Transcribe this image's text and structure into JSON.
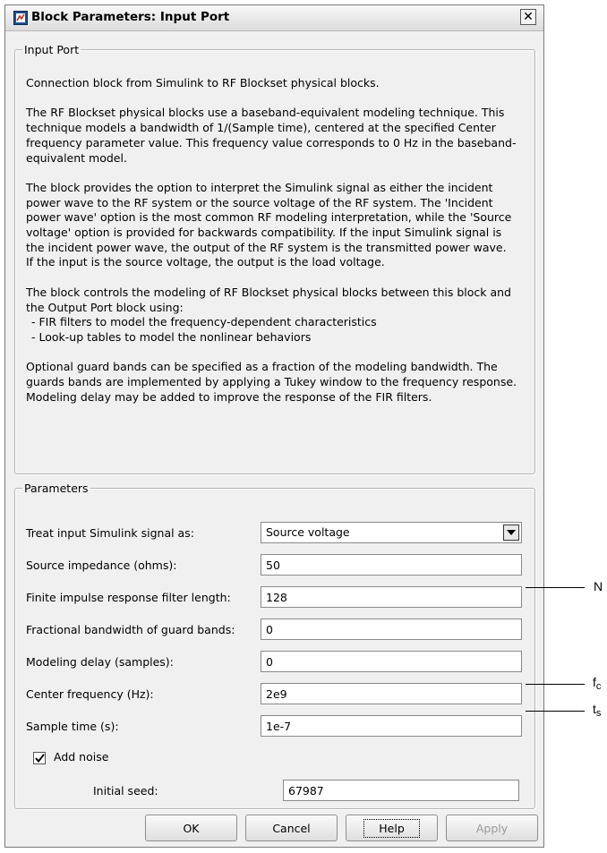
{
  "window": {
    "title": "Block Parameters: Input Port",
    "close_symbol": "✕"
  },
  "description_group": {
    "legend": "Input Port",
    "paragraphs": [
      "Connection block from Simulink to RF Blockset physical blocks.",
      "The RF Blockset physical blocks use a baseband-equivalent modeling technique. This technique models a bandwidth of 1/(Sample time), centered at the specified Center frequency parameter value. This frequency value corresponds to 0 Hz in the baseband-equivalent model.",
      "The block provides the option to interpret the Simulink signal as either the incident power wave to the RF system or the source voltage of the RF system. The 'Incident power wave' option is the most common RF modeling interpretation, while the 'Source voltage' option is provided for backwards compatibility. If the input Simulink signal is the incident power wave, the output of the RF system is the transmitted power wave. If the input is the source voltage, the output is the load voltage.",
      "The block controls the modeling of RF Blockset physical blocks between this block and the Output Port block using:",
      "Optional guard bands can be specified as a fraction of the modeling bandwidth. The guards bands are implemented by applying a Tukey window to the frequency response. Modeling delay may be added to improve the response of the FIR filters."
    ],
    "bullets": [
      "- FIR filters to model the frequency-dependent characteristics",
      "- Look-up tables to model the nonlinear behaviors"
    ]
  },
  "parameters_group": {
    "legend": "Parameters",
    "treat_input": {
      "label": "Treat input Simulink signal as:",
      "value": "Source voltage"
    },
    "source_impedance": {
      "label": "Source impedance (ohms):",
      "value": "50"
    },
    "fir_length": {
      "label": "Finite impulse response filter length:",
      "value": "128"
    },
    "guard_bandwidth": {
      "label": "Fractional bandwidth of guard bands:",
      "value": "0"
    },
    "modeling_delay": {
      "label": "Modeling delay (samples):",
      "value": "0"
    },
    "center_frequency": {
      "label": "Center frequency (Hz):",
      "value": "2e9"
    },
    "sample_time": {
      "label": "Sample time (s):",
      "value": "1e-7"
    },
    "add_noise": {
      "label": "Add noise",
      "checked": true
    },
    "initial_seed": {
      "label": "Initial seed:",
      "value": "67987"
    }
  },
  "buttons": {
    "ok": "OK",
    "cancel": "Cancel",
    "help": "Help",
    "apply": "Apply"
  },
  "callouts": {
    "fir_length": "N",
    "center_frequency": {
      "base": "f",
      "sub": "c"
    },
    "sample_time": {
      "base": "t",
      "sub": "s"
    }
  },
  "colors": {
    "window_bg": "#f0f0f0",
    "group_border": "#b5b5b5",
    "disabled_text": "#9a9a9a"
  },
  "icons": {
    "app": "simulink-block-icon",
    "close": "close-icon",
    "dropdown": "chevron-down-icon",
    "checkbox": "checkmark-icon"
  }
}
